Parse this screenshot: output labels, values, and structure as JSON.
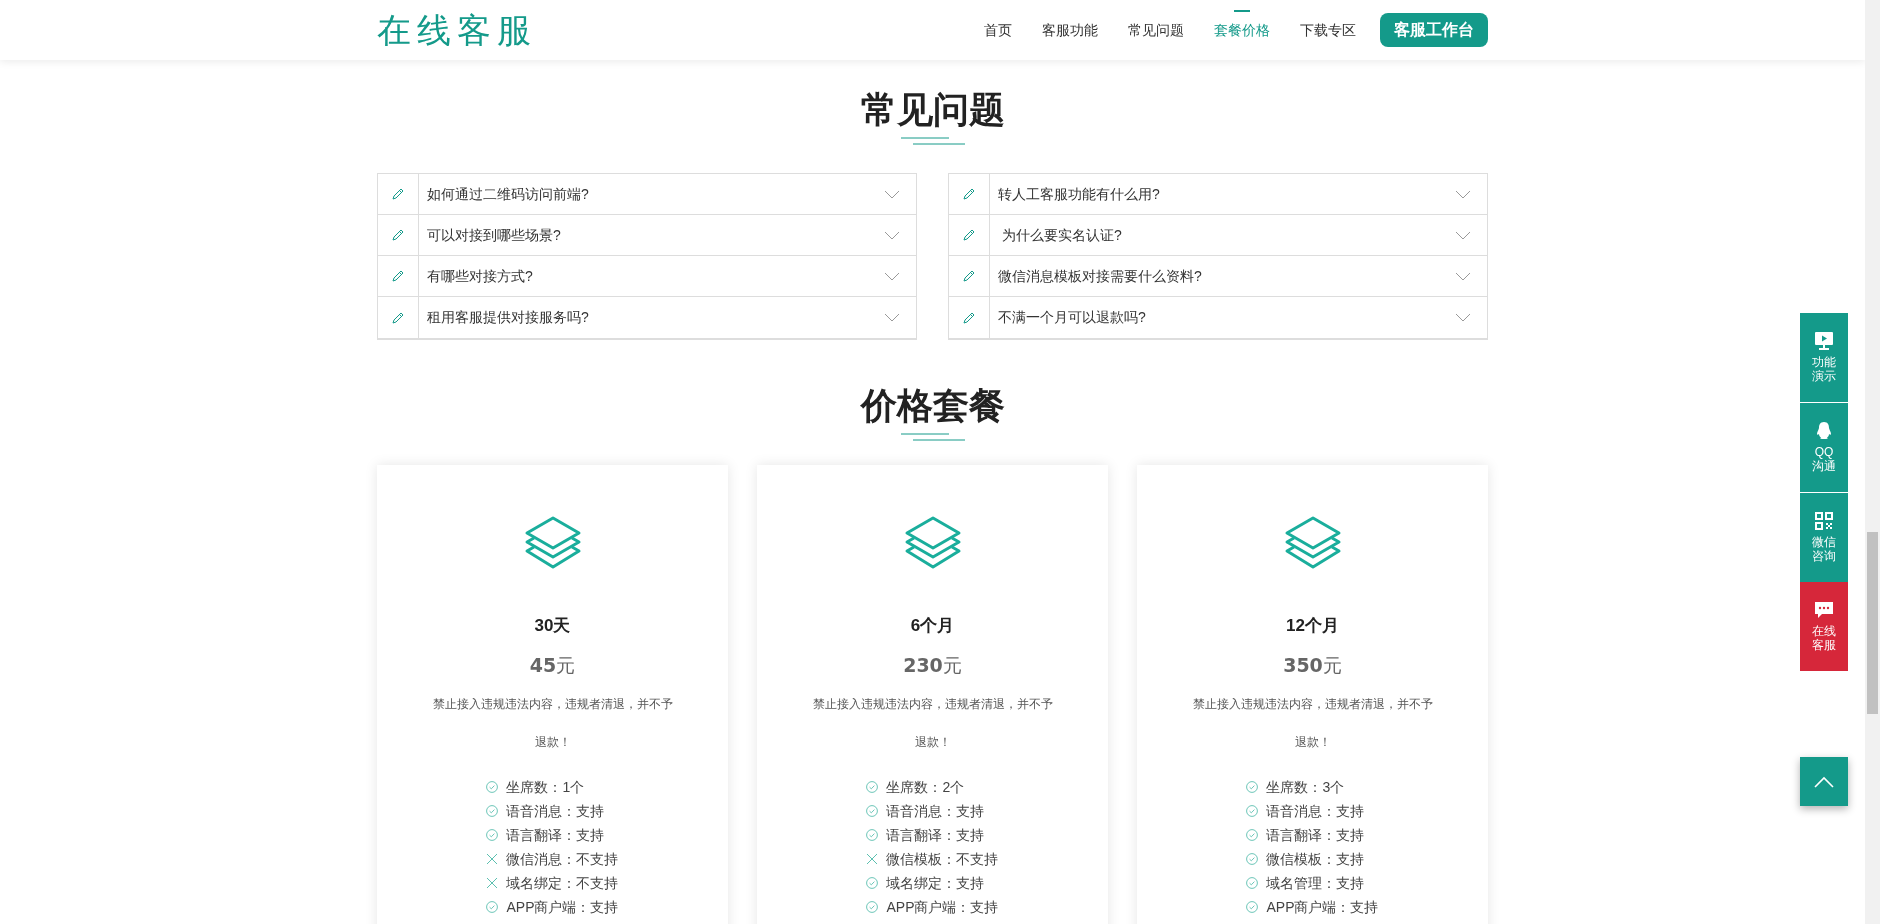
{
  "header": {
    "logo": "在线客服",
    "nav": [
      {
        "label": "首页",
        "selected": false
      },
      {
        "label": "客服功能",
        "selected": false
      },
      {
        "label": "常见问题",
        "selected": false
      },
      {
        "label": "套餐价格",
        "selected": true
      },
      {
        "label": "下载专区",
        "selected": false
      }
    ],
    "cta": "客服工作台"
  },
  "faq": {
    "title": "常见问题",
    "columns": [
      [
        "如何通过二维码访问前端?",
        "可以对接到哪些场景?",
        "有哪些对接方式?",
        "租用客服提供对接服务吗?"
      ],
      [
        "转人工客服功能有什么用?",
        " 为什么要实名认证?",
        "微信消息模板对接需要什么资料?",
        "不满一个月可以退款吗?"
      ]
    ]
  },
  "pricing": {
    "title": "价格套餐",
    "plans": [
      {
        "name": "30天",
        "price": "45",
        "unit": "元",
        "note": "禁止接入违规违法内容，违规者清退，并不予退款！",
        "features": [
          {
            "text": "坐席数：1个",
            "included": true
          },
          {
            "text": "语音消息：支持",
            "included": true
          },
          {
            "text": "语言翻译：支持",
            "included": true
          },
          {
            "text": "微信消息：不支持",
            "included": false
          },
          {
            "text": "域名绑定：不支持",
            "included": false
          },
          {
            "text": "APP商户端：支持",
            "included": true
          }
        ]
      },
      {
        "name": "6个月",
        "price": "230",
        "unit": "元",
        "note": "禁止接入违规违法内容，违规者清退，并不予退款！",
        "features": [
          {
            "text": "坐席数：2个",
            "included": true
          },
          {
            "text": "语音消息：支持",
            "included": true
          },
          {
            "text": "语言翻译：支持",
            "included": true
          },
          {
            "text": "微信模板：不支持",
            "included": false
          },
          {
            "text": "域名绑定：支持",
            "included": true
          },
          {
            "text": "APP商户端：支持",
            "included": true
          }
        ]
      },
      {
        "name": "12个月",
        "price": "350",
        "unit": "元",
        "note": "禁止接入违规违法内容，违规者清退，并不予退款！",
        "features": [
          {
            "text": "坐席数：3个",
            "included": true
          },
          {
            "text": "语音消息：支持",
            "included": true
          },
          {
            "text": "语言翻译：支持",
            "included": true
          },
          {
            "text": "微信模板：支持",
            "included": true
          },
          {
            "text": "域名管理：支持",
            "included": true
          },
          {
            "text": "APP商户端：支持",
            "included": true
          }
        ]
      }
    ]
  },
  "side_toolbar": [
    {
      "kind": "video",
      "lines": [
        "功能",
        "演示"
      ]
    },
    {
      "kind": "qq",
      "lines": [
        "QQ",
        "沟通"
      ]
    },
    {
      "kind": "qrcode",
      "lines": [
        "微信",
        "咨询"
      ]
    },
    {
      "kind": "chat",
      "lines": [
        "在线",
        "客服"
      ]
    }
  ]
}
